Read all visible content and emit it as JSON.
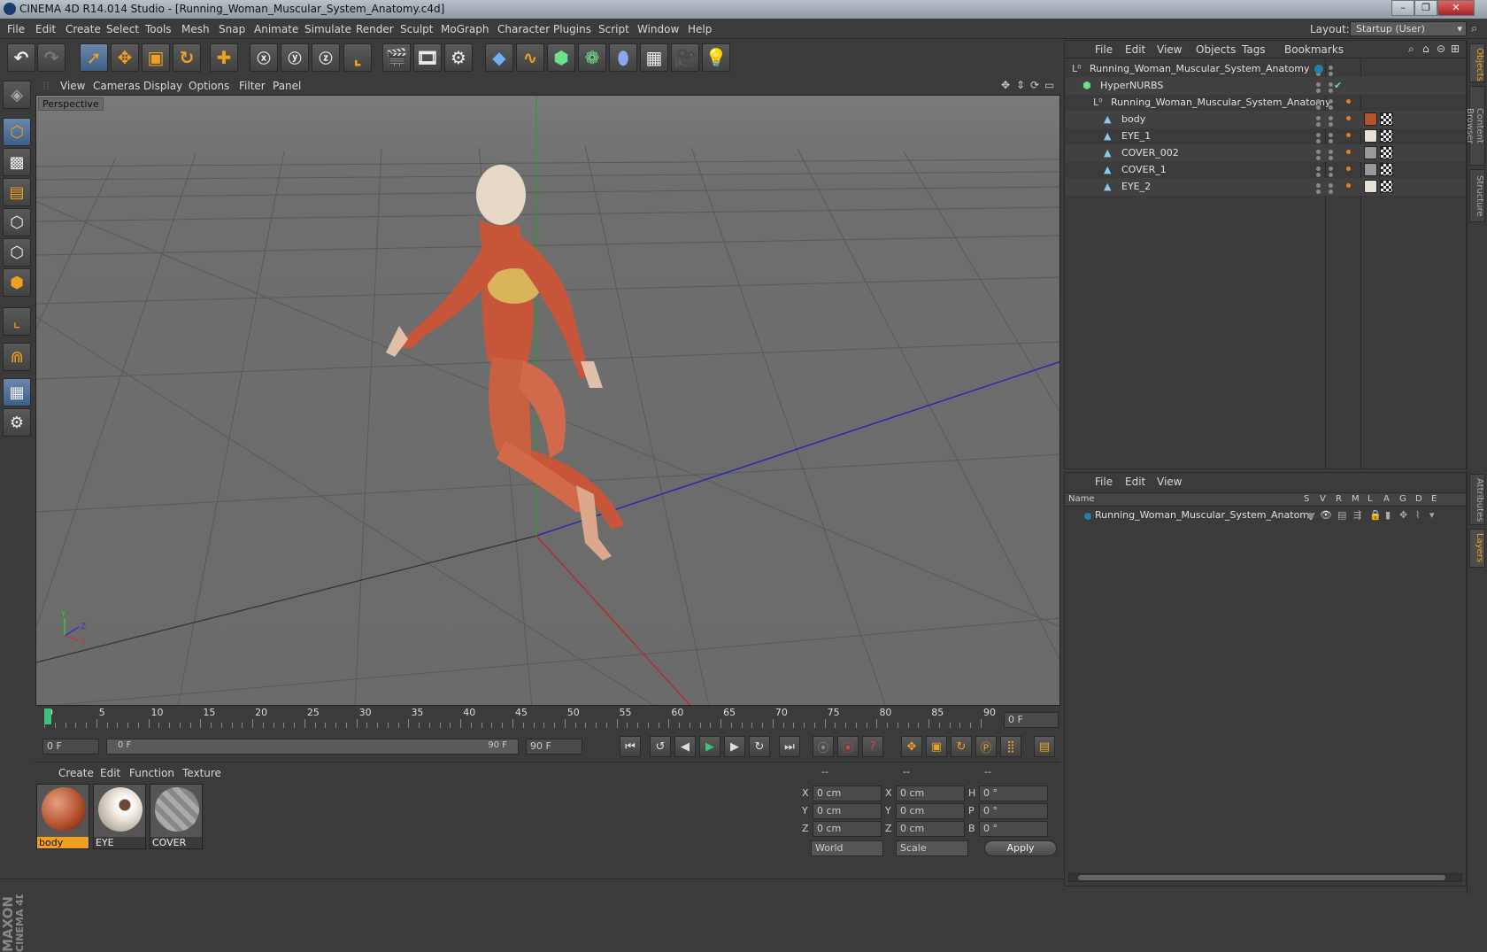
{
  "window": {
    "title": "CINEMA 4D R14.014 Studio - [Running_Woman_Muscular_System_Anatomy.c4d]",
    "minimize": "–",
    "restore": "❐",
    "close": "✕"
  },
  "menu": [
    "File",
    "Edit",
    "Create",
    "Select",
    "Tools",
    "Mesh",
    "Snap",
    "Animate",
    "Simulate",
    "Render",
    "Sculpt",
    "MoGraph",
    "Character",
    "Plugins",
    "Script",
    "Window",
    "Help"
  ],
  "layout": {
    "label": "Layout:",
    "value": "Startup (User)"
  },
  "viewport": {
    "menu": [
      "View",
      "Cameras",
      "Display",
      "Options",
      "Filter",
      "Panel"
    ],
    "label": "Perspective",
    "axis": {
      "y": "Y",
      "z": "Z",
      "x": "X"
    }
  },
  "timeline": {
    "ticks": [
      "0",
      "5",
      "10",
      "15",
      "20",
      "25",
      "30",
      "35",
      "40",
      "45",
      "50",
      "55",
      "60",
      "65",
      "70",
      "75",
      "80",
      "85",
      "90"
    ],
    "current_frame": "0 F"
  },
  "playbar": {
    "start": "0 F",
    "range_start": "0 F",
    "range_end": "90 F",
    "end": "90 F"
  },
  "materials": {
    "menu": [
      "Create",
      "Edit",
      "Function",
      "Texture"
    ],
    "items": [
      {
        "name": "body",
        "color": "#b4532e"
      },
      {
        "name": "EYE",
        "color": "#e8e2d6"
      },
      {
        "name": "COVER",
        "color": "#9a9a9a"
      }
    ]
  },
  "coords": {
    "headers": [
      "--",
      "--",
      "--"
    ],
    "rows": [
      {
        "a": "X",
        "av": "0 cm",
        "b": "X",
        "bv": "0 cm",
        "c": "H",
        "cv": "0 °"
      },
      {
        "a": "Y",
        "av": "0 cm",
        "b": "Y",
        "bv": "0 cm",
        "c": "P",
        "cv": "0 °"
      },
      {
        "a": "Z",
        "av": "0 cm",
        "b": "Z",
        "bv": "0 cm",
        "c": "B",
        "cv": "0 °"
      }
    ],
    "world": "World",
    "scale": "Scale",
    "apply": "Apply"
  },
  "objects": {
    "menu": [
      "File",
      "Edit",
      "View",
      "Objects",
      "Tags",
      "Bookmarks"
    ],
    "tree": [
      {
        "name": "Running_Woman_Muscular_System_Anatomy",
        "level": 0,
        "type": "null"
      },
      {
        "name": "HyperNURBS",
        "level": 1,
        "type": "nurbs"
      },
      {
        "name": "Running_Woman_Muscular_System_Anatomy",
        "level": 2,
        "type": "null"
      },
      {
        "name": "body",
        "level": 3,
        "type": "poly"
      },
      {
        "name": "EYE_1",
        "level": 3,
        "type": "poly"
      },
      {
        "name": "COVER_002",
        "level": 3,
        "type": "poly"
      },
      {
        "name": "COVER_1",
        "level": 3,
        "type": "poly"
      },
      {
        "name": "EYE_2",
        "level": 3,
        "type": "poly"
      }
    ]
  },
  "layers": {
    "menu": [
      "File",
      "Edit",
      "View"
    ],
    "columns": [
      "Name",
      "S",
      "V",
      "R",
      "M",
      "L",
      "A",
      "G",
      "D",
      "E"
    ],
    "rows": [
      "Running_Woman_Muscular_System_Anatomy"
    ]
  },
  "rightTabs": [
    "Objects",
    "Content Browser",
    "Structure",
    "Attributes",
    "Layers"
  ],
  "brand": {
    "line1": "MAXON",
    "line2": "CINEMA 4D"
  }
}
